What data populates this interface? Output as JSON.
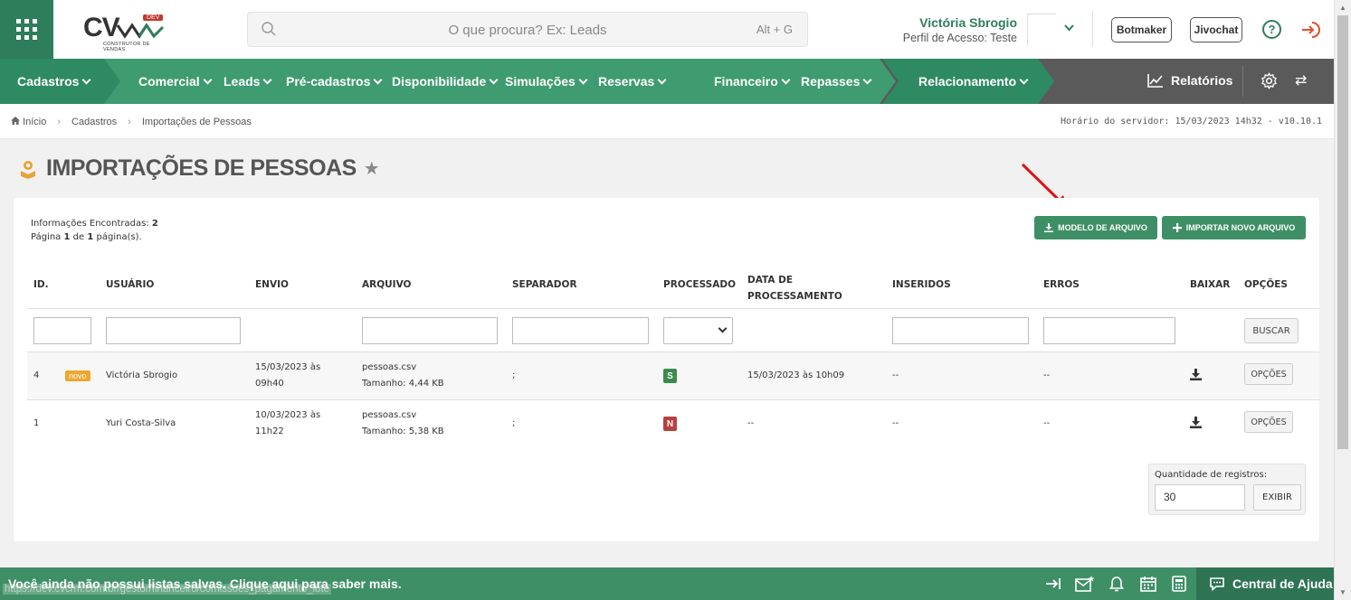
{
  "header": {
    "search_placeholder": "O que procura? Ex: Leads",
    "search_shortcut": "Alt + G",
    "logo_text": "CV",
    "logo_badge": "DEV",
    "logo_sub": "CONSTRUTOR DE VENDAS",
    "user_name": "Victória Sbrogio",
    "user_profile": "Perfil de Acesso: Teste",
    "botmaker": "Botmaker",
    "jivochat": "Jivochat"
  },
  "nav": {
    "items": [
      "Cadastros",
      "Comercial",
      "Leads",
      "Pré-cadastros",
      "Disponibilidade",
      "Simulações",
      "Reservas",
      "Financeiro",
      "Repasses",
      "Relacionamento"
    ],
    "reports": "Relatórios"
  },
  "breadcrumb": {
    "home": "Início",
    "level1": "Cadastros",
    "level2": "Importações de Pessoas",
    "server_time": "Horário do servidor: 15/03/2023 14h32 - v10.10.1"
  },
  "page": {
    "title": "IMPORTAÇÕES DE PESSOAS"
  },
  "summary": {
    "found_label": "Informações Encontradas:",
    "found_count": "2",
    "page_prefix": "Página",
    "page_current": "1",
    "page_of": "de",
    "page_total": "1",
    "page_suffix": "página(s)."
  },
  "actions": {
    "model_file": "MODELO DE ARQUIVO",
    "import_new": "IMPORTAR NOVO ARQUIVO"
  },
  "table": {
    "headers": [
      "ID.",
      "USUÁRIO",
      "ENVIO",
      "ARQUIVO",
      "SEPARADOR",
      "PROCESSADO",
      "DATA DE",
      "PROCESSAMENTO",
      "INSERIDOS",
      "ERROS",
      "BAIXAR",
      "OPÇÕES"
    ],
    "search_btn": "BUSCAR",
    "rows": [
      {
        "id": "4",
        "badge": "novo",
        "user": "Victória Sbrogio",
        "sent_date": "15/03/2023 às",
        "sent_time": "09h40",
        "file": "pessoas.csv",
        "size": "Tamanho: 4,44 KB",
        "separator": ";",
        "processed": "S",
        "processed_at": "15/03/2023 às 10h09",
        "inserted": "--",
        "errors": "--",
        "options": "OPÇÕES"
      },
      {
        "id": "1",
        "badge": "",
        "user": "Yuri Costa-Silva",
        "sent_date": "10/03/2023 às",
        "sent_time": "11h22",
        "file": "pessoas.csv",
        "size": "Tamanho: 5,38 KB",
        "separator": ";",
        "processed": "N",
        "processed_at": "--",
        "inserted": "--",
        "errors": "--",
        "options": "OPÇÕES"
      }
    ]
  },
  "records": {
    "label": "Quantidade de registros:",
    "value": "30",
    "button": "EXIBIR"
  },
  "footer": {
    "message": "Você ainda não possui listas salvas. Clique aqui para saber mais.",
    "status_url": "https://dev.cvcrm.com.br/gestor/financeiro/comissoes_pagamento_lote",
    "help": "Central de Ajuda"
  },
  "colors": {
    "brand": "#2e7d5b",
    "nav_green": "#3f9b70",
    "status_yes": "#3c8a4f",
    "status_no": "#b94040",
    "badge_new": "#f0a62d",
    "annotation_arrow": "#e01010"
  }
}
